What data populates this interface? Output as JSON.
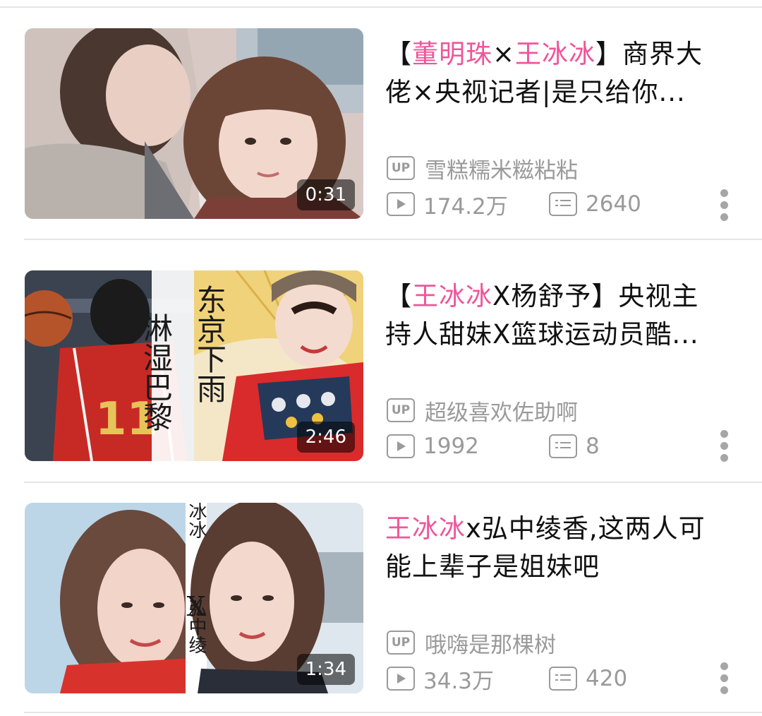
{
  "videos": [
    {
      "title_parts": [
        {
          "text": "【",
          "hl": false
        },
        {
          "text": "董明珠",
          "hl": true
        },
        {
          "text": "×",
          "hl": false
        },
        {
          "text": "王冰冰",
          "hl": true
        },
        {
          "text": "】商界大佬×央视记者|是只给你...",
          "hl": false
        }
      ],
      "title_line1": [
        {
          "text": "【",
          "hl": false
        },
        {
          "text": "董明珠",
          "hl": true
        },
        {
          "text": "×",
          "hl": false
        },
        {
          "text": "王冰冰",
          "hl": true
        },
        {
          "text": "】商界大",
          "hl": false
        }
      ],
      "title_line2": "佬×央视记者|是只给你...",
      "duration": "0:31",
      "uploader": "雪糕糯米糍粘粘",
      "views": "174.2万",
      "danmaku": "2640"
    },
    {
      "title_line1": [
        {
          "text": "【",
          "hl": false
        },
        {
          "text": "王冰冰",
          "hl": true
        },
        {
          "text": "X杨舒予】央视主",
          "hl": false
        }
      ],
      "title_line2": "持人甜妹X篮球运动员酷...",
      "duration": "2:46",
      "uploader": "超级喜欢佐助啊",
      "views": "1992",
      "danmaku": "8",
      "thumb_text": {
        "left": "淋湿巴黎",
        "right": "东京下雨",
        "jersey": "11"
      }
    },
    {
      "title_line1": [
        {
          "text": "王冰冰",
          "hl": true
        },
        {
          "text": "x弘中绫香,这两人可",
          "hl": false
        }
      ],
      "title_line2": "能上辈子是姐妹吧",
      "duration": "1:34",
      "uploader": "哦嗨是那棵树",
      "views": "34.3万",
      "danmaku": "420",
      "thumb_text": {
        "banner_top": "王冰冰",
        "banner_x": "X",
        "banner_bottom": "弘中绫"
      }
    }
  ],
  "up_badge": "UP",
  "icons": {
    "up": "up-badge-icon",
    "views": "play-count-icon",
    "danmaku": "danmaku-icon",
    "more": "more-vertical-icon"
  },
  "colors": {
    "highlight": "#f0559a",
    "meta": "#9a9a9a"
  }
}
